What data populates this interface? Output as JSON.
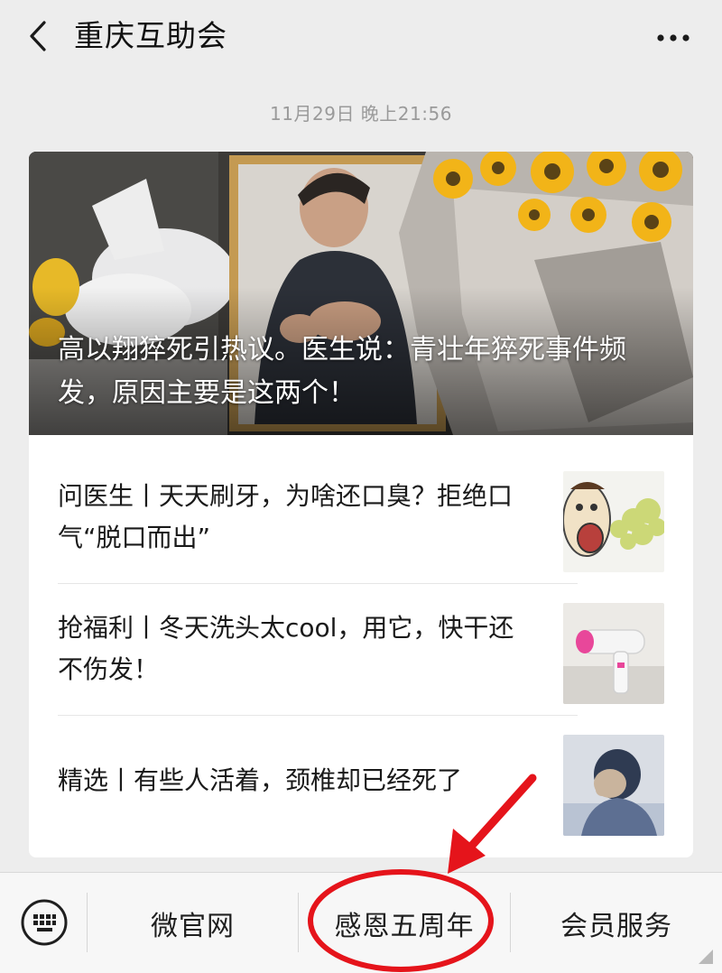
{
  "header": {
    "back_icon": "chevron-left-icon",
    "title": "重庆互助会",
    "more_icon": "more-dots-icon"
  },
  "timestamp": "11月29日 晚上21:56",
  "card": {
    "hero_title": "高以翔猝死引热议。医生说：青壮年猝死事件频发，原因主要是这两个！",
    "articles": [
      {
        "title": "问医生丨天天刷牙，为啥还口臭？拒绝口气“脱口而出”",
        "thumb": "bad-breath-cartoon"
      },
      {
        "title": "抢福利丨冬天洗头太cool，用它，快干还不伤发！",
        "thumb": "hair-dryer"
      },
      {
        "title": "精选丨有些人活着，颈椎却已经死了",
        "thumb": "neck-pain-illustration"
      }
    ]
  },
  "menu": {
    "keyboard_icon": "keyboard-icon",
    "items": [
      "微官网",
      "感恩五周年",
      "会员服务"
    ]
  },
  "colors": {
    "background": "#ededed",
    "card": "#ffffff",
    "annotation_red": "#e5141b"
  }
}
